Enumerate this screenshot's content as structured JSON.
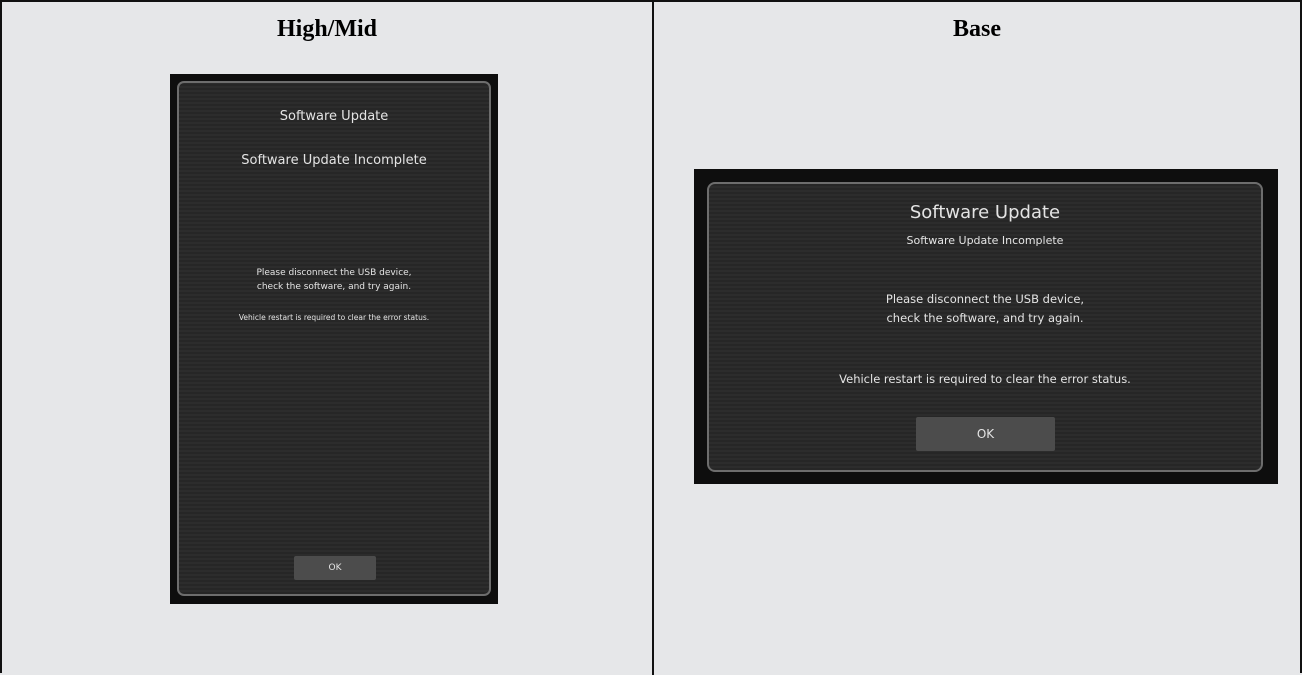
{
  "columns": {
    "left_heading": "High/Mid",
    "right_heading": "Base"
  },
  "high_mid_screen": {
    "title": "Software Update",
    "subtitle": "Software Update Incomplete",
    "message_line1": "Please disconnect the USB device,",
    "message_line2": "check the software, and try again.",
    "note": "Vehicle restart is required to clear the error status.",
    "ok_label": "OK"
  },
  "base_screen": {
    "title": "Software Update",
    "subtitle": "Software Update Incomplete",
    "message_line1": "Please disconnect the USB device,",
    "message_line2": "check the software, and try again.",
    "note": "Vehicle restart is required to clear the error status.",
    "ok_label": "OK"
  }
}
